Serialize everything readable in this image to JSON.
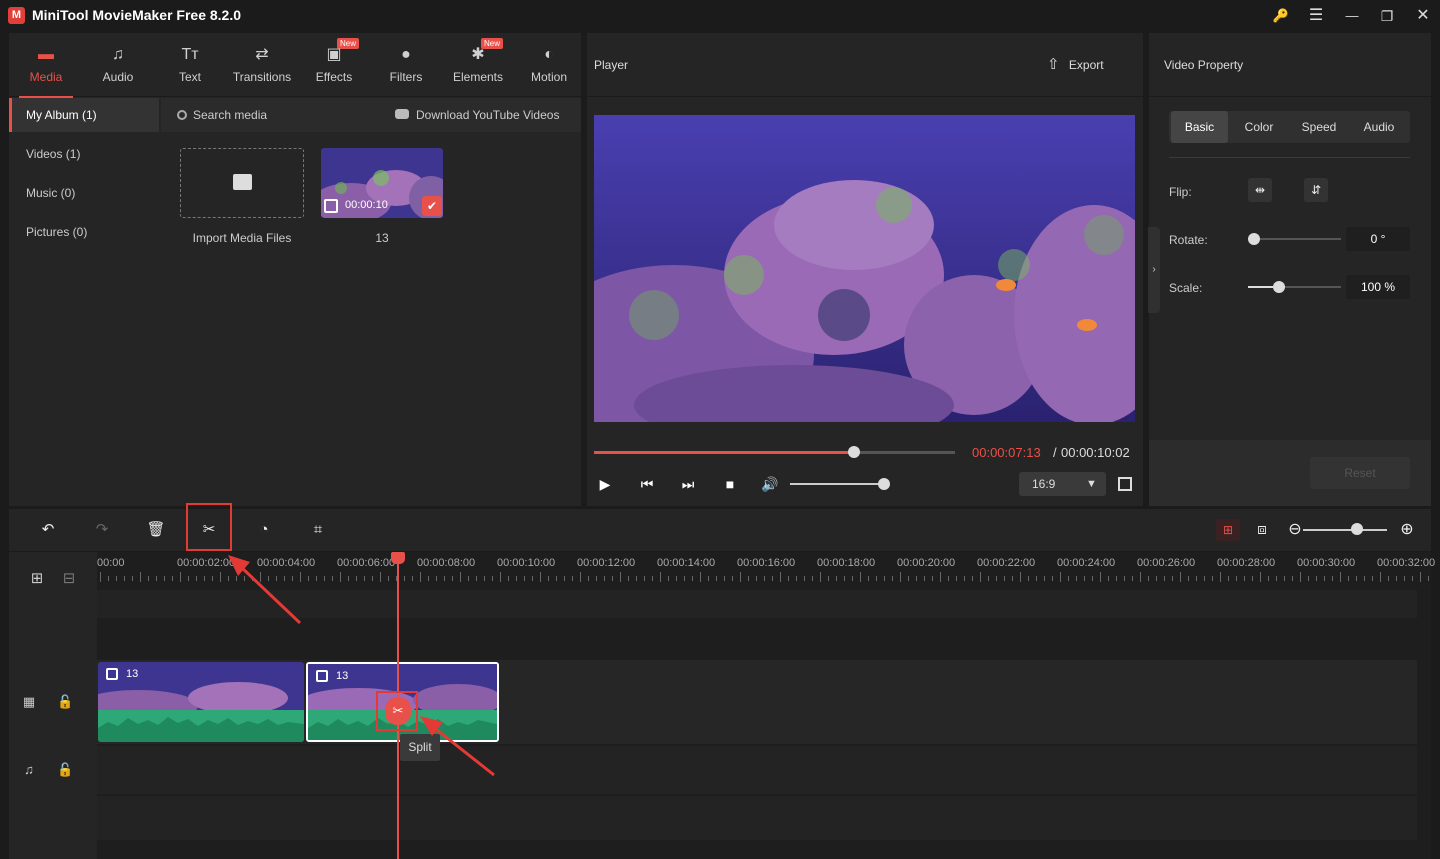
{
  "window": {
    "title": "MiniTool MovieMaker Free 8.2.0",
    "logo_text": "M",
    "controls": {
      "key": "🔑",
      "menu": "☰",
      "minimize": "—",
      "maximize": "❐",
      "close": "✕"
    }
  },
  "tabs": [
    {
      "label": "Media",
      "icon": "▬",
      "active": true
    },
    {
      "label": "Audio",
      "icon": "♫"
    },
    {
      "label": "Text",
      "icon": "Tт"
    },
    {
      "label": "Transitions",
      "icon": "⇄"
    },
    {
      "label": "Effects",
      "icon": "▣",
      "badge": "New"
    },
    {
      "label": "Filters",
      "icon": "●"
    },
    {
      "label": "Elements",
      "icon": "✱",
      "badge": "New"
    },
    {
      "label": "Motion",
      "icon": "◐"
    }
  ],
  "album": {
    "items": [
      {
        "label": "My Album (1)",
        "active": true
      },
      {
        "label": "Videos (1)"
      },
      {
        "label": "Music (0)"
      },
      {
        "label": "Pictures (0)"
      }
    ]
  },
  "media": {
    "search_label": "Search media",
    "youtube_label": "Download YouTube Videos",
    "import_label": "Import Media Files",
    "clip_duration": "00:00:10",
    "clip_name": "13"
  },
  "player": {
    "title": "Player",
    "export_label": "Export",
    "progress": 0.72,
    "time_current": "00:00:07:13",
    "time_separator": "/",
    "time_total": "00:00:10:02",
    "volume": 0.99,
    "aspect_ratio": "16:9"
  },
  "property": {
    "title": "Video Property",
    "tabs": [
      "Basic",
      "Color",
      "Speed",
      "Audio"
    ],
    "active_tab": "Basic",
    "flip_label": "Flip:",
    "rotate_label": "Rotate:",
    "rotate_value": "0 °",
    "rotate_level": 0.0,
    "scale_label": "Scale:",
    "scale_value": "100 %",
    "scale_level": 0.25,
    "reset_label": "Reset"
  },
  "timeline": {
    "ruler_labels": [
      "00:00",
      "00:00:02:00",
      "00:00:04:00",
      "00:00:06:00",
      "00:00:08:00",
      "00:00:10:00",
      "00:00:12:00",
      "00:00:14:00",
      "00:00:16:00",
      "00:00:18:00",
      "00:00:20:00",
      "00:00:22:00",
      "00:00:24:00",
      "00:00:26:00",
      "00:00:28:00",
      "00:00:30:00",
      "00:00:32:00"
    ],
    "clips": [
      {
        "label": "13"
      },
      {
        "label": "13"
      }
    ],
    "split_tooltip": "Split",
    "zoom_level": 0.62
  },
  "colors": {
    "accent": "#e8514a",
    "audio_wave": "#2fa878",
    "video_bg": "#3b2f8a"
  }
}
